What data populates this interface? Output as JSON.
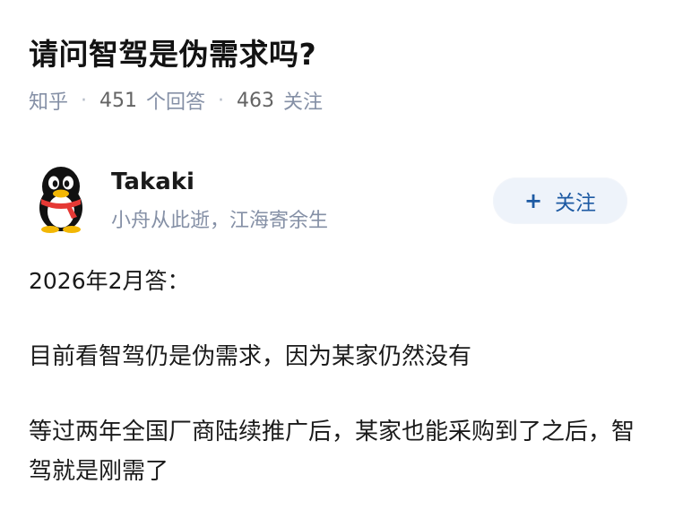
{
  "question": {
    "title": "请问智驾是伪需求吗?",
    "meta": {
      "source": "知乎",
      "answers_count": "451",
      "answers_label": "个回答",
      "followers_count": "463",
      "followers_label": "关注"
    }
  },
  "answer": {
    "author": {
      "name": "Takaki",
      "bio": "小舟从此逝，江海寄余生",
      "avatar_icon": "qq-penguin-icon"
    },
    "follow_button": {
      "icon": "+",
      "label": "关注"
    },
    "date": "2026年2月答：",
    "paragraphs": [
      "目前看智驾仍是伪需求，因为某家仍然没有",
      "等过两年全国厂商陆续推广后，某家也能采购到了之后，智驾就是刚需了"
    ]
  },
  "colors": {
    "meta_gray": "#8590a6",
    "follow_bg": "#eef3fa",
    "follow_text": "#1d5aa3"
  }
}
